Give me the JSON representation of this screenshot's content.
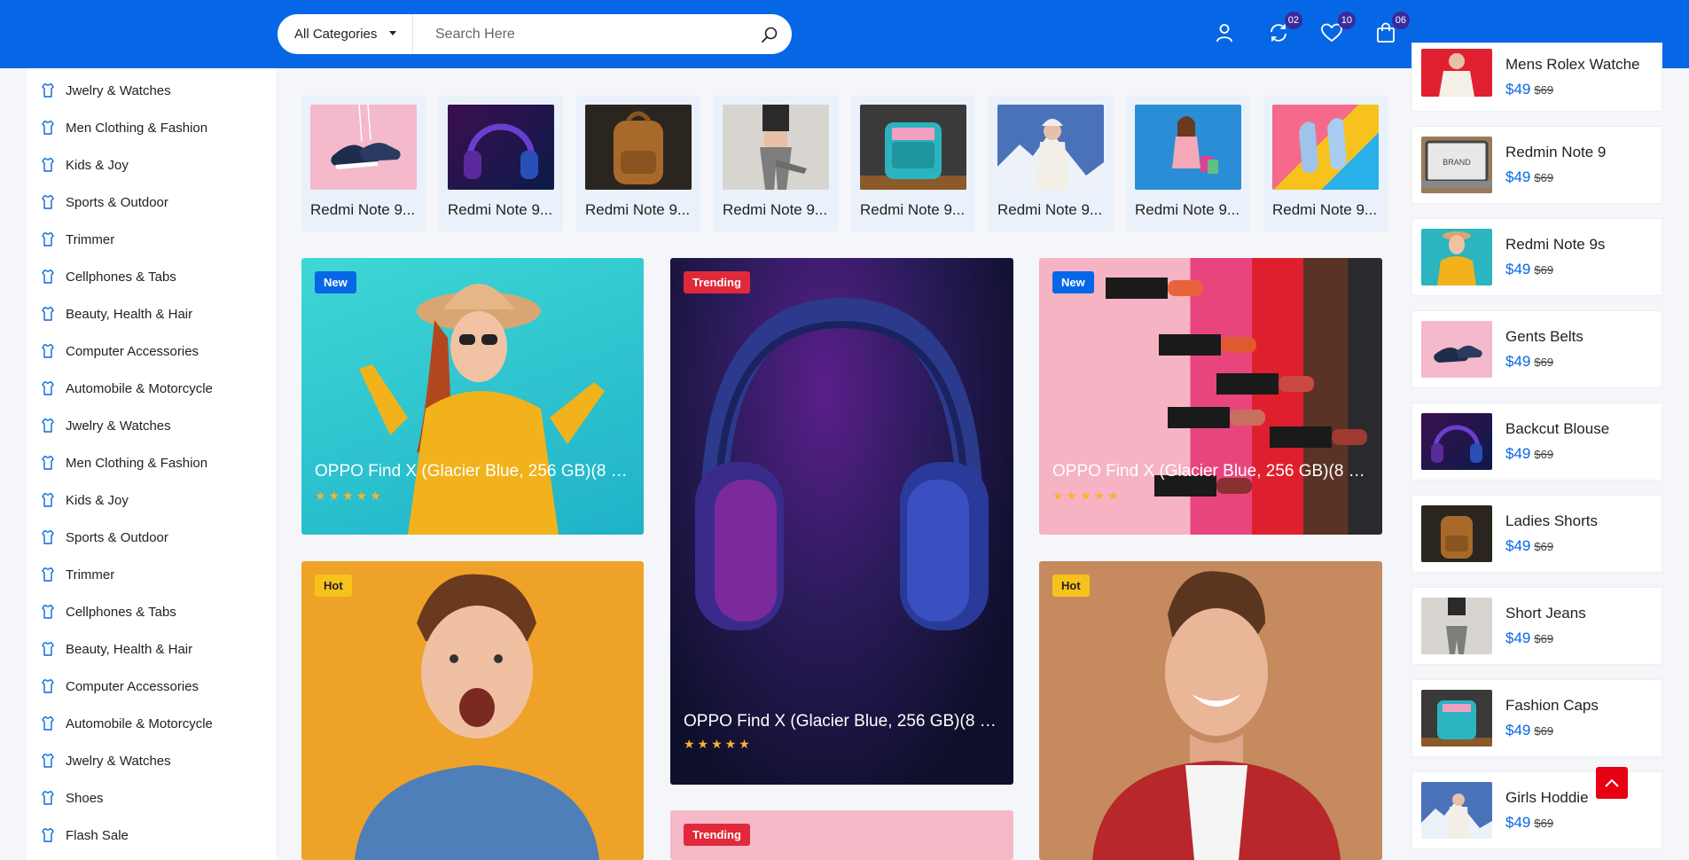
{
  "header": {
    "category_select": "All Categories",
    "search_placeholder": "Search Here",
    "badges": {
      "compare": "02",
      "wishlist": "10",
      "cart": "06"
    }
  },
  "sidebar": {
    "items": [
      {
        "label": "Jwelry & Watches"
      },
      {
        "label": "Men Clothing & Fashion"
      },
      {
        "label": "Kids & Joy"
      },
      {
        "label": "Sports & Outdoor"
      },
      {
        "label": "Trimmer"
      },
      {
        "label": "Cellphones & Tabs"
      },
      {
        "label": "Beauty, Health & Hair"
      },
      {
        "label": "Computer Accessories"
      },
      {
        "label": "Automobile & Motorcycle"
      },
      {
        "label": "Jwelry & Watches"
      },
      {
        "label": "Men Clothing & Fashion"
      },
      {
        "label": "Kids & Joy"
      },
      {
        "label": "Sports & Outdoor"
      },
      {
        "label": "Trimmer"
      },
      {
        "label": "Cellphones & Tabs"
      },
      {
        "label": "Beauty, Health & Hair"
      },
      {
        "label": "Computer Accessories"
      },
      {
        "label": "Automobile & Motorcycle"
      },
      {
        "label": "Jwelry & Watches"
      },
      {
        "label": "Shoes"
      },
      {
        "label": "Flash Sale"
      }
    ]
  },
  "thumbs": [
    {
      "name": "Redmi Note 9..."
    },
    {
      "name": "Redmi Note 9..."
    },
    {
      "name": "Redmi Note 9..."
    },
    {
      "name": "Redmi Note 9..."
    },
    {
      "name": "Redmi Note 9..."
    },
    {
      "name": "Redmi Note 9..."
    },
    {
      "name": "Redmi Note 9..."
    },
    {
      "name": "Redmi Note 9..."
    }
  ],
  "cards": [
    {
      "tag": "New",
      "title": "OPPO Find X (Glacier Blue, 256 GB)(8 G...",
      "stars": "★★★★★"
    },
    {
      "tag": "Trending",
      "title": "OPPO Find X (Glacier Blue, 256 GB)(8 G...",
      "stars": "★★★★★"
    },
    {
      "tag": "New",
      "title": "OPPO Find X (Glacier Blue, 256 GB)(8 G...",
      "stars": "★★★★★"
    },
    {
      "tag": "Hot"
    },
    {
      "tag": "Hot"
    },
    {
      "tag": "Trending"
    }
  ],
  "right_list": [
    {
      "name": "Mens Rolex Watche",
      "price": "$49",
      "old": "$69"
    },
    {
      "name": "Redmin Note 9",
      "price": "$49",
      "old": "$69",
      "brand": "BRAND"
    },
    {
      "name": "Redmi Note 9s",
      "price": "$49",
      "old": "$69"
    },
    {
      "name": "Gents Belts",
      "price": "$49",
      "old": "$69"
    },
    {
      "name": "Backcut Blouse",
      "price": "$49",
      "old": "$69"
    },
    {
      "name": "Ladies Shorts",
      "price": "$49",
      "old": "$69"
    },
    {
      "name": "Short Jeans",
      "price": "$49",
      "old": "$69"
    },
    {
      "name": "Fashion Caps",
      "price": "$49",
      "old": "$69"
    },
    {
      "name": "Girls Hoddie",
      "price": "$49",
      "old": "$69"
    }
  ],
  "colors": {
    "primary": "#0667e6",
    "badge": "#3a2a9c",
    "trending": "#e2293b",
    "hot": "#f8c21c",
    "star": "#f9b233",
    "scroll_top": "#e60012"
  }
}
